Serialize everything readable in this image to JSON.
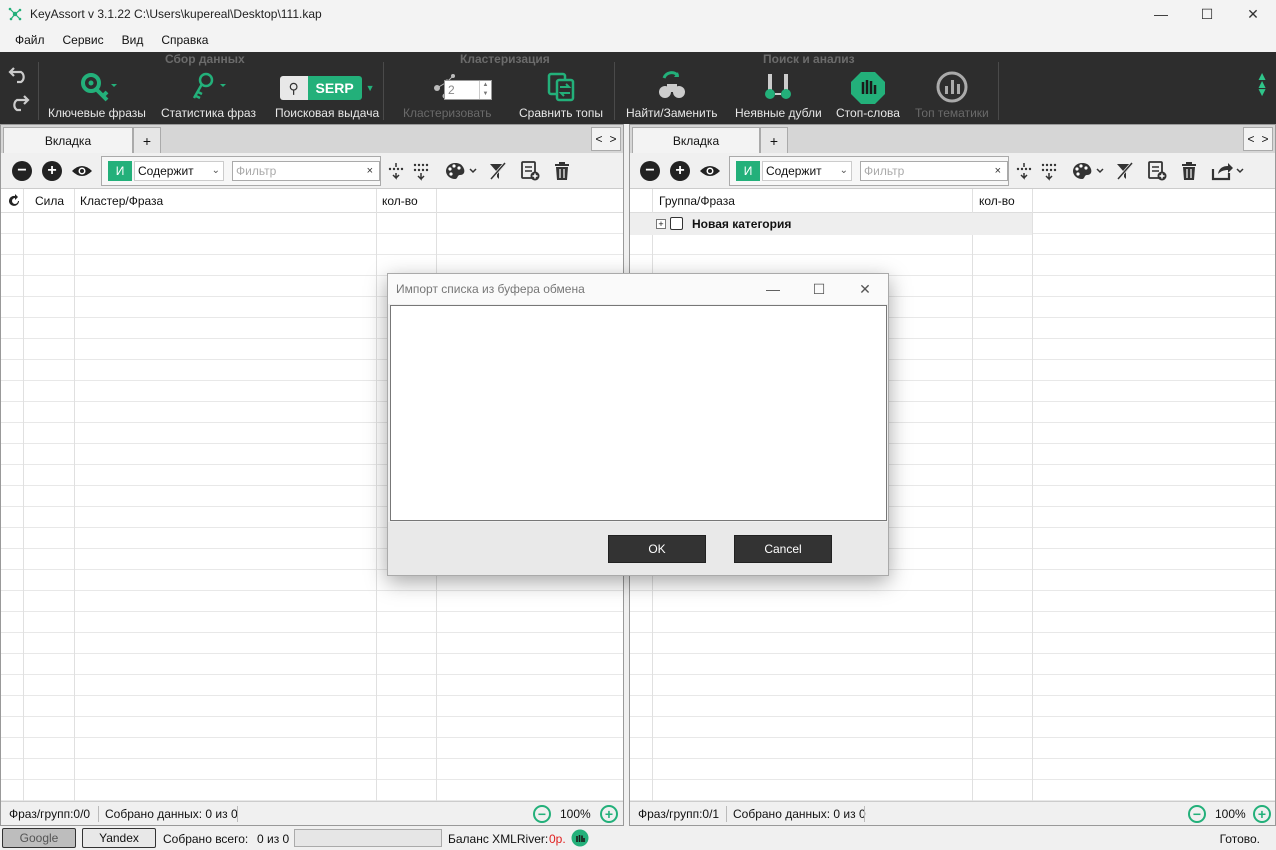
{
  "window": {
    "title": "KeyAssort v 3.1.22  C:\\Users\\kupereal\\Desktop\\111.kap",
    "controls": [
      "—",
      "☐",
      "✕"
    ]
  },
  "menu": [
    "Файл",
    "Сервис",
    "Вид",
    "Справка"
  ],
  "ribbon": {
    "groups": {
      "collect": "Сбор данных",
      "cluster": "Кластеризация",
      "search": "Поиск и анализ"
    },
    "buttons": {
      "keywords": "Ключевые фразы",
      "phrase_stats": "Статистика фраз",
      "serp": "Поисковая выдача",
      "serp_badge": "SERP",
      "clusterize": "Кластеризовать",
      "cluster_value": "2",
      "compare_tops": "Сравнить топы",
      "find_replace": "Найти/Заменить",
      "implicit_dupes": "Неявные дубли",
      "stop_words": "Стоп-слова",
      "top_topics": "Топ тематики"
    }
  },
  "left_pane": {
    "tab_label": "Вкладка",
    "tab_add": "+",
    "nav_prev": "<",
    "nav_next": ">",
    "filter": {
      "mode": "И",
      "condition": "Содержит",
      "placeholder": "Фильтр",
      "clear": "×"
    },
    "columns": {
      "strength": "Сила",
      "cluster_phrase": "Кластер/Фраза",
      "count": "кол-во"
    },
    "status": {
      "phrases": "Фраз/групп:0/0",
      "collected": "Собрано данных: 0 из 0",
      "zoom": "100%"
    }
  },
  "right_pane": {
    "tab_label": "Вкладка",
    "tab_add": "+",
    "nav_prev": "<",
    "nav_next": ">",
    "filter": {
      "mode": "И",
      "condition": "Содержит",
      "placeholder": "Фильтр",
      "clear": "×"
    },
    "columns": {
      "group_phrase": "Группа/Фраза",
      "count": "кол-во"
    },
    "rows": [
      {
        "label": "Новая категория"
      }
    ],
    "status": {
      "phrases": "Фраз/групп:0/1",
      "collected": "Собрано данных: 0 из 0",
      "zoom": "100%"
    }
  },
  "bottombar": {
    "google": "Google",
    "yandex": "Yandex",
    "collected_total_label": "Собрано всего:",
    "collected_total_value": "0 из 0",
    "balance_label": "Баланс XMLRiver:",
    "balance_value": "0р.",
    "status": "Готово."
  },
  "dialog": {
    "title": "Импорт списка из буфера обмена",
    "controls": [
      "—",
      "☐",
      "✕"
    ],
    "text_value": "",
    "ok": "OK",
    "cancel": "Cancel"
  },
  "colors": {
    "accent": "#23b07a",
    "ribbon_bg": "#2d2d2d",
    "balance": "#e02020"
  }
}
